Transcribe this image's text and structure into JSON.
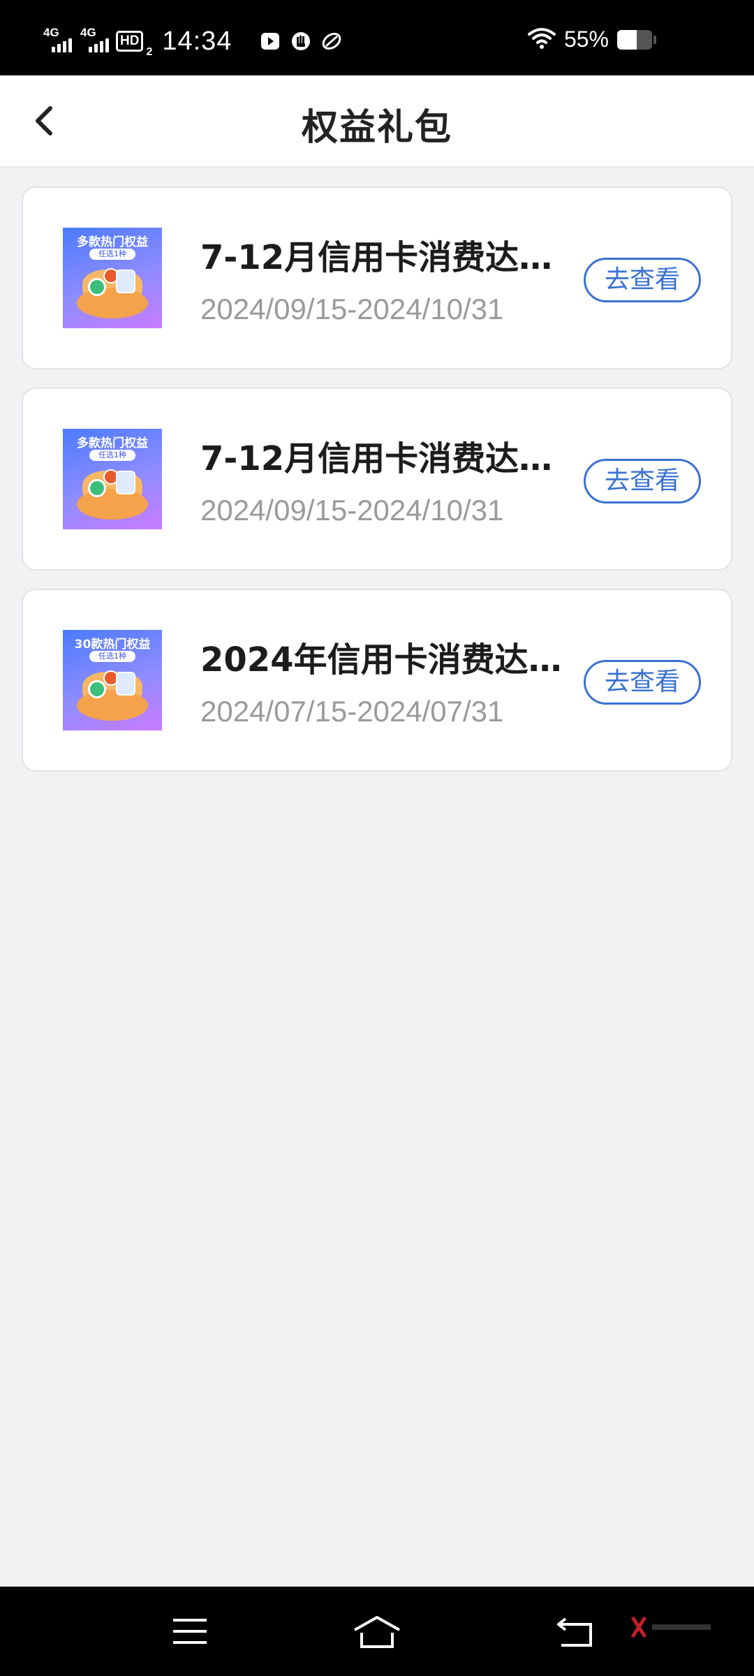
{
  "status_bar": {
    "network1": "4G",
    "network2": "4G",
    "hd": "HD",
    "hd_sub": "2",
    "time": "14:34",
    "battery": "55%",
    "battery_level": 0.55
  },
  "header": {
    "title": "权益礼包"
  },
  "cards": [
    {
      "thumb_title": "多款热门权益",
      "thumb_sub": "任选1种",
      "title": "7-12月信用卡消费达…",
      "date": "2024/09/15-2024/10/31",
      "button": "去查看"
    },
    {
      "thumb_title": "多款热门权益",
      "thumb_sub": "任选1种",
      "title": "7-12月信用卡消费达…",
      "date": "2024/09/15-2024/10/31",
      "button": "去查看"
    },
    {
      "thumb_title": "30款热门权益",
      "thumb_sub": "任选1种",
      "title": "2024年信用卡消费达…",
      "date": "2024/07/15-2024/07/31",
      "button": "去查看"
    }
  ],
  "colors": {
    "accent": "#3a71d1",
    "background": "#f2f2f4",
    "status_bar": "#000000"
  }
}
